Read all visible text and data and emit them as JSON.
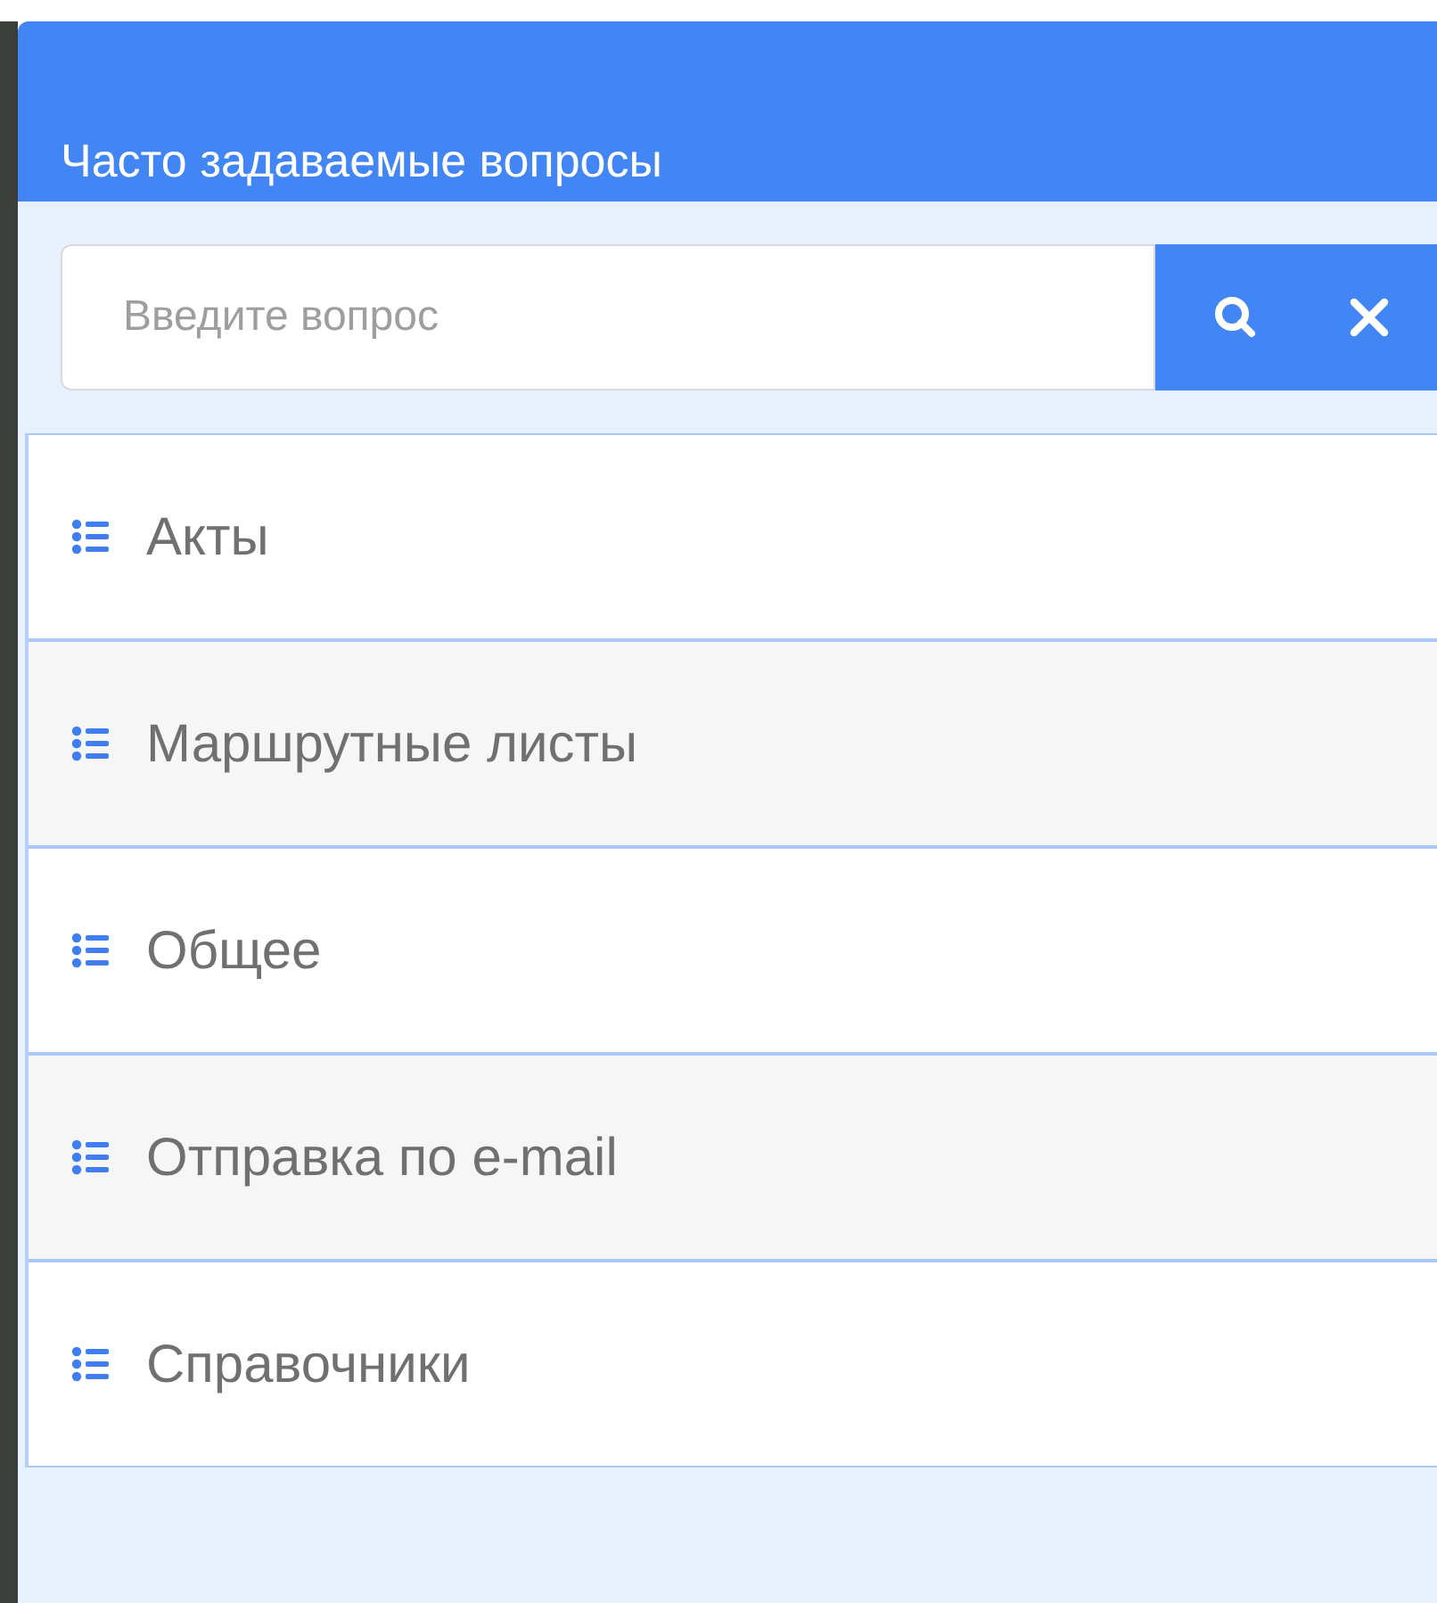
{
  "header": {
    "title": "Часто задаваемые вопросы"
  },
  "search": {
    "placeholder": "Введите вопрос"
  },
  "categories": [
    {
      "label": "Акты"
    },
    {
      "label": "Маршрутные листы"
    },
    {
      "label": "Общее"
    },
    {
      "label": "Отправка по e-mail"
    },
    {
      "label": "Справочники"
    }
  ]
}
